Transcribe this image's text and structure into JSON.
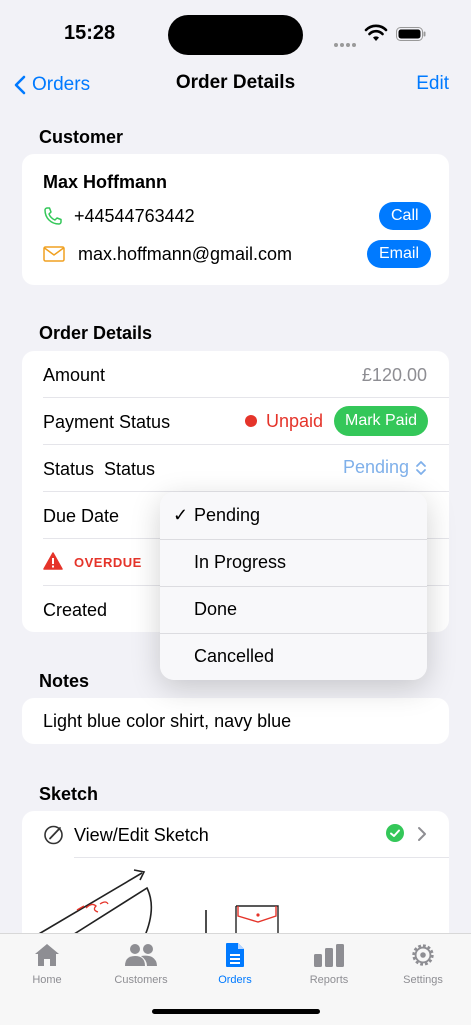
{
  "status_bar": {
    "time": "15:28"
  },
  "nav": {
    "back_label": "Orders",
    "title": "Order Details",
    "edit_label": "Edit"
  },
  "customer": {
    "header": "Customer",
    "name": "Max Hoffmann",
    "phone": "+44544763442",
    "call_label": "Call",
    "email": "max.hoffmann@gmail.com",
    "email_label": "Email"
  },
  "order_details": {
    "header": "Order Details",
    "amount_label": "Amount",
    "amount_value": "£120.00",
    "payment_status_label": "Payment Status",
    "payment_status_value": "Unpaid",
    "mark_paid_label": "Mark Paid",
    "status_label": "Status  Status",
    "status_value": "Pending",
    "due_date_label": "Due Date",
    "overdue_label": "OVERDUE",
    "created_label": "Created"
  },
  "status_menu": {
    "options": [
      "Pending",
      "In Progress",
      "Done",
      "Cancelled"
    ],
    "selected": "Pending"
  },
  "notes": {
    "header": "Notes",
    "text": "Light blue color shirt, navy blue"
  },
  "sketch": {
    "header": "Sketch",
    "view_edit_label": "View/Edit Sketch"
  },
  "tabbar": {
    "tabs": [
      {
        "label": "Home",
        "icon": "house-icon"
      },
      {
        "label": "Customers",
        "icon": "people-icon"
      },
      {
        "label": "Orders",
        "icon": "document-icon"
      },
      {
        "label": "Reports",
        "icon": "bar-chart-icon"
      },
      {
        "label": "Settings",
        "icon": "gear-icon"
      }
    ],
    "active": "Orders"
  },
  "colors": {
    "accent": "#007aff",
    "danger": "#e5342a",
    "success": "#34c759",
    "background": "#f2f2f7"
  }
}
